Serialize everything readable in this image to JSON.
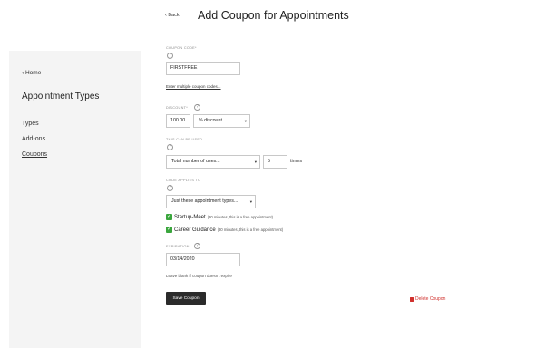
{
  "header": {
    "back_label": "‹ Back",
    "title": "Add Coupon for Appointments"
  },
  "sidebar": {
    "back_label": "‹ Home",
    "title": "Appointment Types",
    "items": [
      {
        "label": "Types",
        "active": false
      },
      {
        "label": "Add-ons",
        "active": false
      },
      {
        "label": "Coupons",
        "active": true
      }
    ]
  },
  "form": {
    "coupon_code": {
      "label": "COUPON CODE*",
      "value": "FIRSTFREE",
      "multi_link": "Enter multiple coupon codes..."
    },
    "discount": {
      "label": "DISCOUNT*",
      "value": "100.00",
      "type_selected": "% discount"
    },
    "usage": {
      "label": "THIS CAN BE USED",
      "selected": "Total number of uses...",
      "count": "5",
      "suffix": "times"
    },
    "applies": {
      "label": "CODE APPLIES TO",
      "selected": "Just these appointment types...",
      "options": [
        {
          "name": "Startup-Meet",
          "desc": "(30 minutes, this is a free appointment)",
          "checked": true
        },
        {
          "name": "Career Guidance",
          "desc": "(30 minutes, this is a free appointment)",
          "checked": true
        }
      ]
    },
    "expiration": {
      "label": "EXPIRATION",
      "value": "03/14/2020",
      "hint": "Leave blank if coupon doesn't expire"
    }
  },
  "actions": {
    "save_label": "Save Coupon",
    "delete_label": "Delete Coupon"
  },
  "colors": {
    "check_green": "#3aa63d",
    "delete_red": "#d0302d",
    "button_dark": "#2b2b2b",
    "sidebar_bg": "#f4f4f4"
  }
}
